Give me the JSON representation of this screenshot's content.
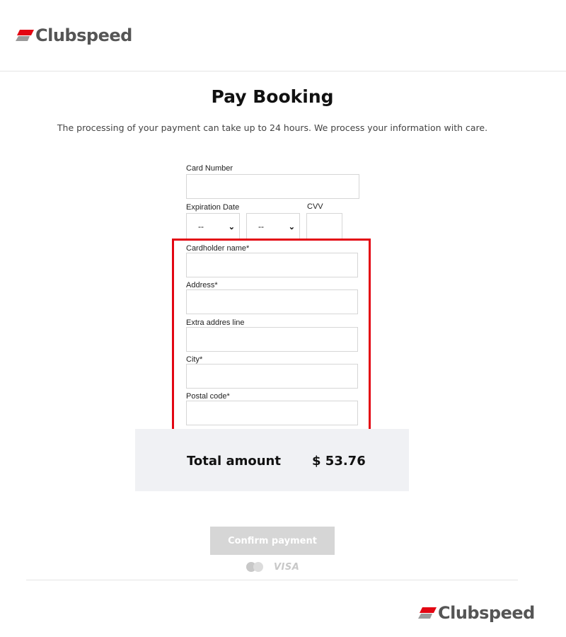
{
  "brand": {
    "name": "Clubspeed",
    "accent_color": "#e30613",
    "logo_icon": "clubspeed-logo-icon"
  },
  "page": {
    "title": "Pay Booking",
    "subtitle": "The processing of your payment can take up to 24 hours. We process your information with care."
  },
  "form": {
    "card_number_label": "Card Number",
    "card_number_value": "",
    "expiration_label": "Expiration Date",
    "expiration_month": "--",
    "expiration_year": "--",
    "cvv_label": "CVV",
    "cvv_value": "",
    "cardholder_label": "Cardholder name*",
    "cardholder_value": "",
    "address_label": "Address*",
    "address_value": "",
    "extra_address_label": "Extra addres line",
    "extra_address_value": "",
    "city_label": "City*",
    "city_value": "",
    "postal_label": "Postal code*",
    "postal_value": ""
  },
  "summary": {
    "total_label": "Total amount",
    "total_value": "$ 53.76"
  },
  "actions": {
    "confirm_label": "Confirm payment"
  },
  "payment_methods": {
    "mastercard_icon": "mastercard-icon",
    "visa_label": "VISA"
  }
}
